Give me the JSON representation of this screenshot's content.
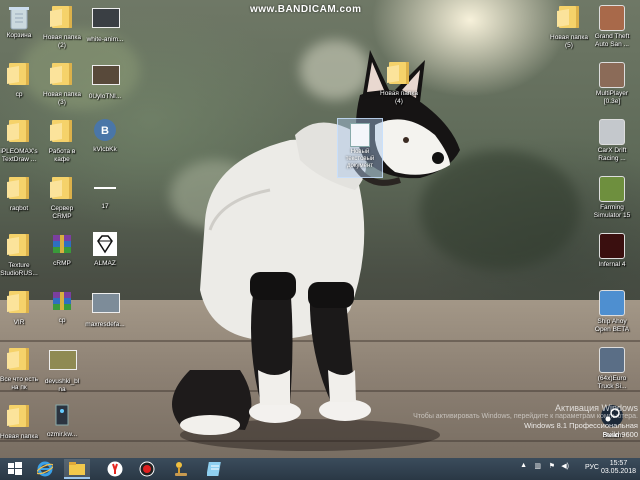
{
  "watermark": "www.BANDICAM.com",
  "desktop": {
    "left_icons": [
      {
        "label": "Корзина",
        "icon": "recycle-bin-icon",
        "kind": "bin"
      },
      {
        "label": "Новая папка\n(2)",
        "icon": "folder-icon",
        "kind": "folder"
      },
      {
        "label": "white-anim...",
        "icon": "image-thumb-icon",
        "kind": "thumb",
        "color": "#3a3f44"
      },
      {
        "label": "ср",
        "icon": "folder-icon",
        "kind": "folder"
      },
      {
        "label": "Новая папка\n(3)",
        "icon": "folder-icon",
        "kind": "folder"
      },
      {
        "label": "0UyloTNI...",
        "icon": "image-thumb-icon",
        "kind": "thumb",
        "color": "#58493a"
      },
      {
        "label": "iPLEOMAX's\nTextDraw ...",
        "icon": "folder-icon",
        "kind": "folder"
      },
      {
        "label": "Работа в\nкафе",
        "icon": "folder-icon",
        "kind": "folder"
      },
      {
        "label": "kVlcbKk",
        "icon": "vk-icon",
        "kind": "vk"
      },
      {
        "label": "raqbot",
        "icon": "folder-icon",
        "kind": "folder"
      },
      {
        "label": "Сервер\nCRMP",
        "icon": "folder-icon",
        "kind": "folder"
      },
      {
        "label": "17",
        "icon": "blank-file-icon",
        "kind": "blank"
      },
      {
        "label": "Texture\nStudioRUS...",
        "icon": "folder-icon",
        "kind": "folder"
      },
      {
        "label": "cRMP",
        "icon": "winrar-icon",
        "kind": "rar"
      },
      {
        "label": "ALMAZ",
        "icon": "diamond-icon",
        "kind": "diamond"
      },
      {
        "label": "VIR",
        "icon": "folder-icon",
        "kind": "folder"
      },
      {
        "label": "ср",
        "icon": "winrar-icon",
        "kind": "rar"
      },
      {
        "label": "maxresdefa...",
        "icon": "image-thumb-icon",
        "kind": "thumb",
        "color": "#7d8c99"
      },
      {
        "label": "Все что есть\nна пк",
        "icon": "folder-icon",
        "kind": "folder"
      },
      {
        "label": "devushki_bl\nna",
        "icon": "image-thumb-icon",
        "kind": "thumb",
        "color": "#8f8a52"
      },
      {
        "label": "",
        "icon": "",
        "kind": "none"
      },
      {
        "label": "Новая папка",
        "icon": "folder-icon",
        "kind": "folder"
      },
      {
        "label": "ozmir.kw...",
        "icon": "exe-icon",
        "kind": "exe"
      }
    ],
    "right_icons": [
      {
        "label": "Новая папка\n(5)",
        "icon": "folder-icon",
        "kind": "folder"
      },
      {
        "label": "Grand Theft\nAuto San ...",
        "icon": "gta-sa-icon",
        "kind": "game",
        "color": "#a8694a"
      },
      {
        "label": "MultiPlayer\n[0.3e]",
        "icon": "samp-icon",
        "kind": "game",
        "color": "#8b6b58"
      },
      {
        "label": "CarX Drift\nRacing ...",
        "icon": "carx-icon",
        "kind": "game",
        "color": "#c4c8cc"
      },
      {
        "label": "Farming\nSimulator 15",
        "icon": "farming-sim-icon",
        "kind": "game",
        "color": "#6e8f3e"
      },
      {
        "label": "Infernal 4",
        "icon": "infernal-icon",
        "kind": "game",
        "color": "#3a0f0f"
      },
      {
        "label": "Ship Ahoy\nOpen BETA",
        "icon": "ship-ahoy-icon",
        "kind": "game",
        "color": "#4e8fd0"
      },
      {
        "label": "(64x)Euro\nTruck Si...",
        "icon": "euro-truck-icon",
        "kind": "game",
        "color": "#5a6e86"
      },
      {
        "label": "Steam",
        "icon": "steam-icon",
        "kind": "steam"
      }
    ],
    "middle_icons": [
      {
        "label": "Новая папка\n(4)",
        "icon": "folder-icon"
      }
    ],
    "selected_doc": {
      "label": "Новый\nтекстовый\nдокумент",
      "icon": "text-document-icon"
    }
  },
  "activation": {
    "title": "Активация Windows",
    "hint": "Чтобы активировать Windows, перейдите к параметрам компьютера.",
    "os": "Windows 8.1 Профессиональная",
    "build": "Build 9600"
  },
  "taskbar": {
    "items": [
      {
        "name": "start-button",
        "icon": "windows-logo-icon"
      },
      {
        "name": "internet-explorer-button",
        "icon": "ie-icon"
      },
      {
        "name": "file-explorer-button",
        "icon": "folder-icon"
      },
      {
        "name": "yandex-browser-button",
        "icon": "yandex-icon"
      },
      {
        "name": "bandicam-button",
        "icon": "record-icon"
      },
      {
        "name": "pin-app-button",
        "icon": "joystick-icon"
      },
      {
        "name": "notepad-button",
        "icon": "notepad-icon"
      }
    ],
    "tray": {
      "language": "РУС",
      "time": "15:57",
      "date": "03.05.2018"
    }
  }
}
